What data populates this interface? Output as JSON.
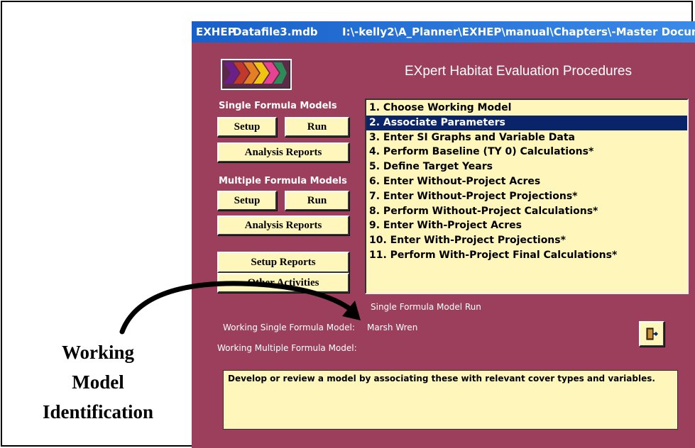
{
  "window": {
    "title_app": "EXHEP",
    "title_file": "Datafile3.mdb",
    "title_path": "I:\\-kelly2\\A_Planner\\EXHEP\\manual\\Chapters\\-Master Docum..."
  },
  "app_title": "EXpert Habitat Evaluation Procedures",
  "single": {
    "heading": "Single Formula Models",
    "setup_label": "Setup",
    "run_label": "Run",
    "reports_label": "Analysis Reports"
  },
  "multiple": {
    "heading": "Multiple Formula Models",
    "setup_label": "Setup",
    "run_label": "Run",
    "reports_label": "Analysis Reports"
  },
  "setup_reports_label": "Setup Reports",
  "other_activities_label": "Other Activities",
  "steps": [
    "1. Choose Working Model",
    "2. Associate Parameters",
    "3. Enter SI Graphs and Variable Data",
    "4. Perform Baseline (TY 0) Calculations*",
    "5. Define Target Years",
    "6. Enter Without-Project Acres",
    "7. Enter Without-Project Projections*",
    "8. Perform Without-Project Calculations*",
    "9. Enter With-Project Acres",
    "10. Enter With-Project Projections*",
    "11. Perform With-Project Final Calculations*"
  ],
  "selected_step_index": 1,
  "mode_label": "Single Formula Model Run",
  "working_single_label": "Working Single Formula Model:",
  "working_single_value": "Marsh Wren",
  "working_multiple_label": "Working Multiple Formula Model:",
  "working_multiple_value": "",
  "description": "Develop or review a model by associating these with relevant cover types and variables.",
  "exit_icon": "exit-door-icon",
  "callout": {
    "line1": "Working",
    "line2": "Model",
    "line3": "Identification"
  },
  "colors": {
    "window_bg": "#9b3f5d",
    "button_bg": "#fff6bc",
    "selection": "#0a246a",
    "titlebar": "#1860c8"
  }
}
